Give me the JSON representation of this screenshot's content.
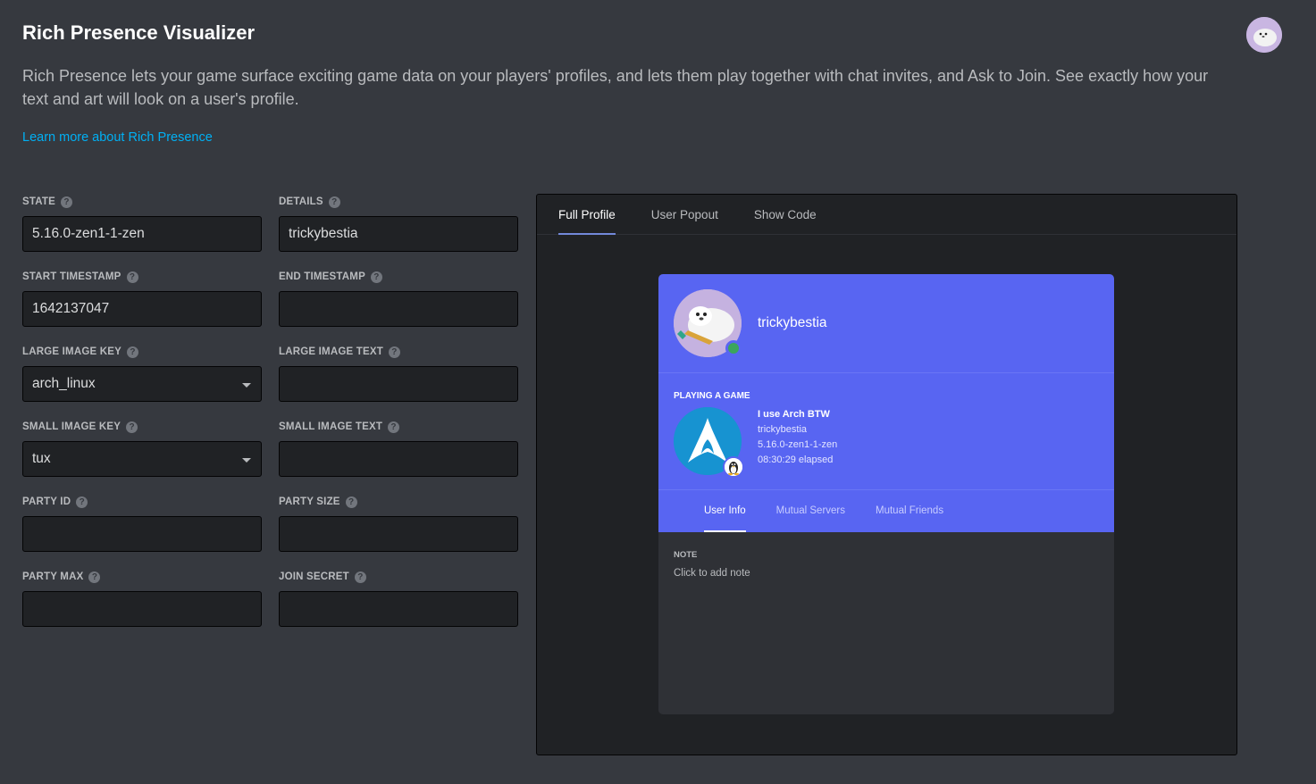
{
  "header": {
    "title": "Rich Presence Visualizer",
    "description": "Rich Presence lets your game surface exciting game data on your players' profiles, and lets them play together with chat invites, and Ask to Join. See exactly how your text and art will look on a user's profile.",
    "learn_more": "Learn more about Rich Presence",
    "avatar_icon": "seal-avatar-icon"
  },
  "form": {
    "state": {
      "label": "STATE",
      "value": "5.16.0-zen1-1-zen"
    },
    "details": {
      "label": "DETAILS",
      "value": "trickybestia"
    },
    "start_timestamp": {
      "label": "START TIMESTAMP",
      "value": "1642137047"
    },
    "end_timestamp": {
      "label": "END TIMESTAMP",
      "value": ""
    },
    "large_image_key": {
      "label": "LARGE IMAGE KEY",
      "value": "arch_linux"
    },
    "large_image_text": {
      "label": "LARGE IMAGE TEXT",
      "value": ""
    },
    "small_image_key": {
      "label": "SMALL IMAGE KEY",
      "value": "tux"
    },
    "small_image_text": {
      "label": "SMALL IMAGE TEXT",
      "value": ""
    },
    "party_id": {
      "label": "PARTY ID",
      "value": ""
    },
    "party_size": {
      "label": "PARTY SIZE",
      "value": ""
    },
    "party_max": {
      "label": "PARTY MAX",
      "value": ""
    },
    "join_secret": {
      "label": "JOIN SECRET",
      "value": ""
    },
    "help_glyph": "?"
  },
  "preview": {
    "tabs": [
      "Full Profile",
      "User Popout",
      "Show Code"
    ],
    "active_tab": "Full Profile",
    "profile": {
      "username": "trickybestia",
      "status_color": "#3ba55d",
      "activity_heading": "PLAYING A GAME",
      "game_name": "I use Arch BTW",
      "details": "trickybestia",
      "state": "5.16.0-zen1-1-zen",
      "elapsed": "08:30:29 elapsed",
      "tabs": [
        "User Info",
        "Mutual Servers",
        "Mutual Friends"
      ],
      "active_tab": "User Info",
      "note_label": "NOTE",
      "note_placeholder": "Click to add note"
    }
  },
  "colors": {
    "background": "#36393f",
    "accent": "#5865f2",
    "link": "#00b0f4"
  }
}
